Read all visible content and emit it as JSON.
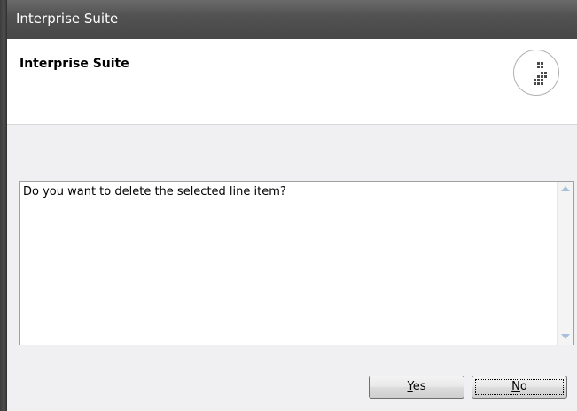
{
  "window": {
    "title": "Interprise Suite"
  },
  "header": {
    "title": "Interprise Suite",
    "logo_icon": "interprise-logo-icon"
  },
  "message": {
    "text": "Do you want to delete the selected line item?"
  },
  "buttons": {
    "yes_label_mnemonic": "Y",
    "yes_label_rest": "es",
    "no_label_mnemonic": "N",
    "no_label_rest": "o"
  },
  "colors": {
    "titlebar": "#4f4f4f",
    "content_bg": "#f0f0f2",
    "scroll_arrow": "#a7c1dc"
  }
}
